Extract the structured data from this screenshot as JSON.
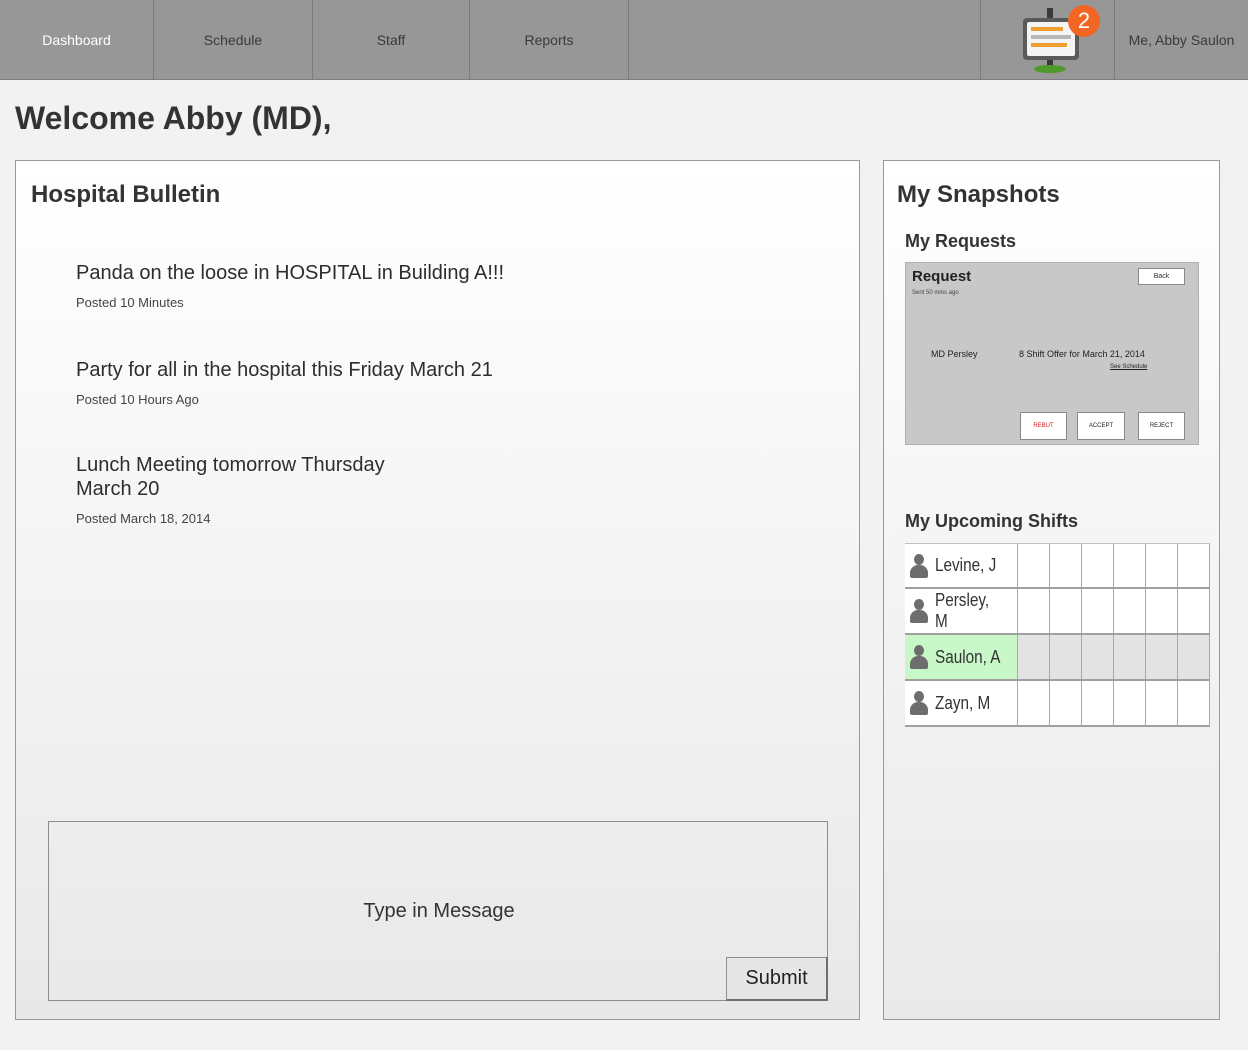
{
  "nav": {
    "items": [
      {
        "label": "Dashboard",
        "active": true
      },
      {
        "label": "Schedule",
        "active": false
      },
      {
        "label": "Staff",
        "active": false
      },
      {
        "label": "Reports",
        "active": false
      }
    ],
    "notification_count": "2",
    "notification_icon": "bulletin-board-icon",
    "user_label": "Me, Abby Saulon"
  },
  "welcome": "Welcome Abby (MD),",
  "bulletin": {
    "title": "Hospital Bulletin",
    "posts": [
      {
        "title": "Panda on the loose in HOSPITAL in Building A!!!",
        "meta": "Posted 10 Minutes"
      },
      {
        "title": "Party for all in the hospital this Friday March 21",
        "meta": "Posted 10 Hours Ago"
      },
      {
        "title": "Lunch Meeting tomorrow Thursday March 20",
        "meta": "Posted March 18, 2014"
      }
    ],
    "message_placeholder": "Type in Message",
    "submit_label": "Submit"
  },
  "snapshots": {
    "title": "My Snapshots",
    "requests_title": "My Requests",
    "request": {
      "title": "Request",
      "sent": "Sent 50 mins ago",
      "back_label": "Back",
      "from": "MD Persley",
      "offer": "8 Shift Offer for March 21, 2014",
      "see_schedule": "See Schedule",
      "rebut_label": "REBUT",
      "accept_label": "ACCEPT",
      "reject_label": "REJECT"
    },
    "shifts_title": "My Upcoming Shifts",
    "shifts": [
      {
        "name": "Levine, J",
        "highlight": false
      },
      {
        "name": "Persley, M",
        "highlight": false
      },
      {
        "name": "Saulon, A",
        "highlight": true
      },
      {
        "name": "Zayn, M",
        "highlight": false
      }
    ]
  },
  "colors": {
    "nav_bg": "#979797",
    "badge": "#f26522",
    "highlight_green": "#c8f7c8",
    "rebut_red": "#d02020"
  }
}
